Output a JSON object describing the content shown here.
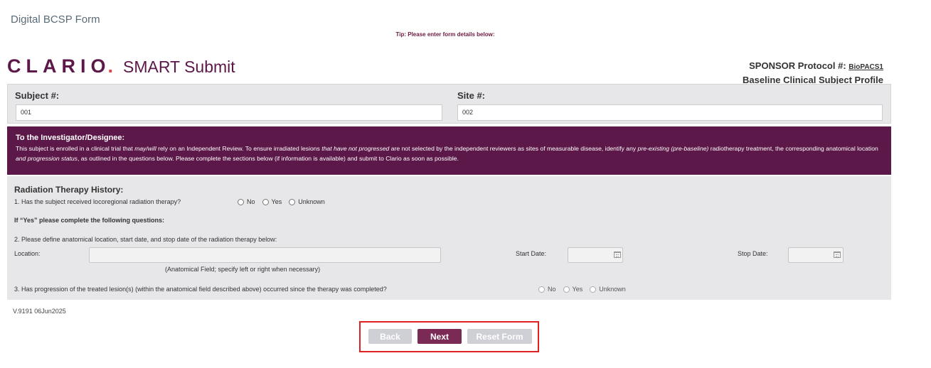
{
  "app_title": "Digital BCSP Form",
  "tip": "Tip: Please enter form details below:",
  "logo": {
    "word": "CLARIO",
    "dot": ".",
    "product": "SMART Submit"
  },
  "sponsor": {
    "label": "SPONSOR Protocol #: ",
    "protocol": "BioPACS1",
    "profile": "Baseline Clinical Subject Profile"
  },
  "subject": {
    "label": "Subject #:",
    "value": "001",
    "site_label": "Site #:",
    "site_value": "002"
  },
  "investigator": {
    "heading": "To the Investigator/Designee:",
    "p1": "This subject is enrolled in a clinical trial that ",
    "p1_em": "may/will",
    "p2": " rely on an Independent Review. To ensure irradiated lesions ",
    "p2_em": "that have not progressed",
    "p3": " are not selected by the independent reviewers as sites of measurable disease, identify any ",
    "p3_em": "pre-existing (pre-baseline)",
    "p4": " radiotherapy treatment, the corresponding anatomical location ",
    "p4_em": "and progression status",
    "p5": ", as outlined in the questions below. Please complete the sections below (if information is available) and submit to Clario as soon as possible."
  },
  "radiation": {
    "heading": "Radiation Therapy History:",
    "q1": "1. Has the subject received locoregional radiation therapy?",
    "options": [
      "No",
      "Yes",
      "Unknown"
    ],
    "if_yes": "If “Yes” please complete the following questions:",
    "q2": "2. Please define anatomical location, start date, and stop date of the radiation therapy below:",
    "location_label": "Location:",
    "location_hint": "(Anatomical Field; specify left or right when necessary)",
    "start_label": "Start Date:",
    "stop_label": "Stop Date:",
    "q3": "3. Has progression of the treated lesion(s) (within the anatomical field described above) occurred since the therapy was completed?"
  },
  "version": "V.9191 06Jun2025",
  "buttons": {
    "back": "Back",
    "next": "Next",
    "reset": "Reset Form"
  },
  "colors": {
    "brand": "#5b1848",
    "brand_dot": "#e0474c",
    "next_button": "#7b2a55",
    "highlight_frame": "#e02020"
  }
}
